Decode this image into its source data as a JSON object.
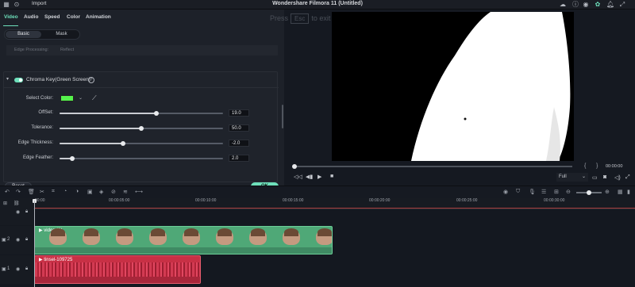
{
  "app": {
    "title": "Wondershare Filmora 11 (Untitled)",
    "import_label": "Import"
  },
  "panel": {
    "tabs": [
      {
        "label": "Video",
        "active": true
      },
      {
        "label": "Audio"
      },
      {
        "label": "Speed"
      },
      {
        "label": "Color"
      },
      {
        "label": "Animation"
      }
    ],
    "segments": [
      "Basic",
      "Mask"
    ],
    "edge_processing": {
      "label": "Edge Processing:",
      "value": "Reflect"
    },
    "chroma": {
      "title": "Chroma Key(Green Screen)",
      "enabled": true,
      "select_color_label": "Select Color:",
      "selected_color": "#55f24c",
      "params": [
        {
          "label": "OffSet:",
          "value": "19.0",
          "fraction": 0.59
        },
        {
          "label": "Tolerance:",
          "value": "50.0",
          "fraction": 0.5
        },
        {
          "label": "Edge Thickness:",
          "value": "-2.0",
          "fraction": 0.39
        },
        {
          "label": "Edge Feather:",
          "value": "2.0",
          "fraction": 0.08
        }
      ]
    },
    "reset_label": "Reset",
    "ok_label": "OK"
  },
  "preview": {
    "hint_press": "Press",
    "hint_key": "Esc",
    "hint_rest": "to exit full screen",
    "timecode": "00:00:00",
    "quality": "Full"
  },
  "timeline": {
    "ruler": [
      "00:00",
      "00:00:05:00",
      "00:00:10:00",
      "00:00:15:00",
      "00:00:20:00",
      "00:00:25:00",
      "00:00:30:00"
    ],
    "tracks": [
      {
        "index": "2",
        "clip": "video (1)"
      },
      {
        "index": "1",
        "clip": "tinsel-109725"
      }
    ]
  },
  "colors": {
    "accent": "#6ee0bb",
    "green_clip": "#4fa877",
    "red_clip": "#c83045"
  }
}
